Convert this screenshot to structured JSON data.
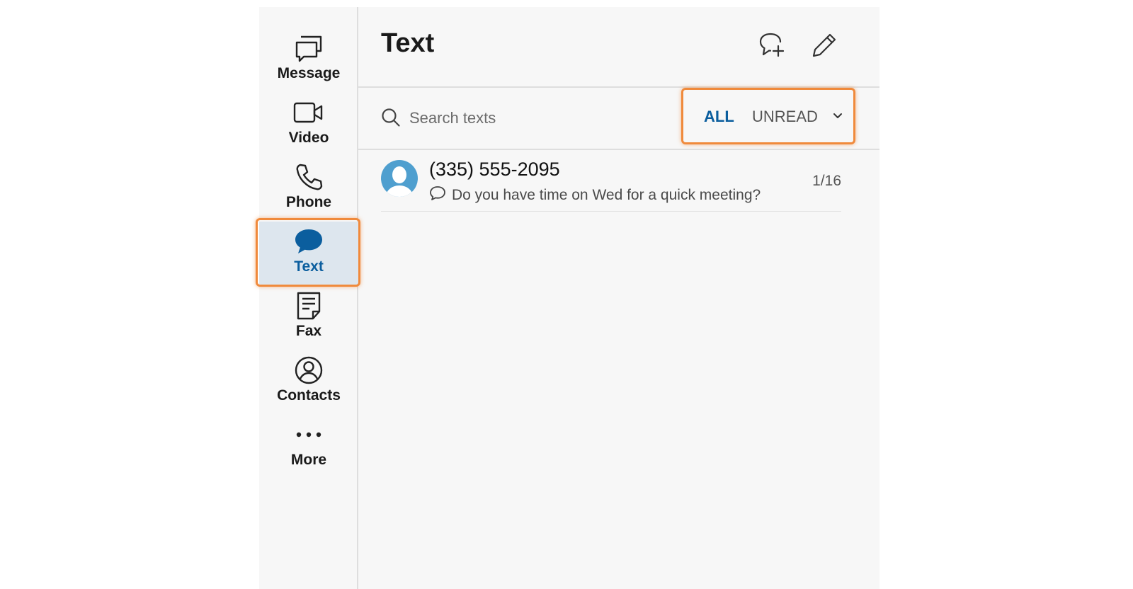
{
  "sidebar": {
    "items": [
      {
        "label": "Message",
        "icon": "message-icon",
        "active": false
      },
      {
        "label": "Video",
        "icon": "video-icon",
        "active": false
      },
      {
        "label": "Phone",
        "icon": "phone-icon",
        "active": false
      },
      {
        "label": "Text",
        "icon": "text-bubble-icon",
        "active": true
      },
      {
        "label": "Fax",
        "icon": "fax-icon",
        "active": false
      },
      {
        "label": "Contacts",
        "icon": "contacts-icon",
        "active": false
      },
      {
        "label": "More",
        "icon": "more-icon",
        "active": false
      }
    ]
  },
  "header": {
    "title": "Text",
    "new_chat_icon": "new-chat-icon",
    "compose_icon": "pencil-icon"
  },
  "search": {
    "placeholder": "Search texts",
    "value": ""
  },
  "filters": {
    "all_label": "ALL",
    "unread_label": "UNREAD",
    "selected": "ALL"
  },
  "conversations": [
    {
      "name": "(335) 555-2095",
      "preview": "Do you have time on Wed for a quick meeting?",
      "count": "1/16"
    }
  ],
  "colors": {
    "accent": "#0b5e9e",
    "highlight": "#f08a3c",
    "active_bg": "#dde6ee",
    "avatar": "#4f9fcf"
  }
}
